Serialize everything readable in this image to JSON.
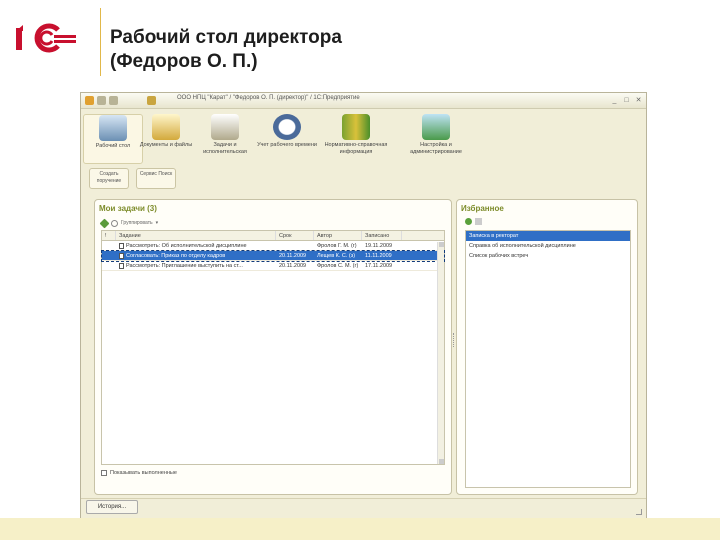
{
  "slide": {
    "title": "Рабочий стол директора\n(Федоров О. П.)",
    "accent_color": "#c8102e"
  },
  "window": {
    "title": "ООО НПЦ \"Карат\" / \"Федоров О. П. (директор)\" / 1С:Предприятие"
  },
  "sections": [
    {
      "label": "Рабочий стол",
      "icon": "desktop-icon"
    },
    {
      "label": "Документы и файлы",
      "icon": "documents-icon"
    },
    {
      "label": "Задачи и исполнительская",
      "icon": "tasks-icon"
    },
    {
      "label": "Учет рабочего времени",
      "icon": "clock-icon"
    },
    {
      "label": "Нормативно-справочная информация",
      "icon": "books-icon"
    },
    {
      "label": "Настройка и администрирование",
      "icon": "settings-icon"
    }
  ],
  "quick_buttons": [
    {
      "label": "Создать поручение"
    },
    {
      "label": "Сервис Поиск"
    }
  ],
  "tasks": {
    "title": "Мои задачи (3)",
    "group_label": "Группировать",
    "columns": [
      "Задание",
      "Срок",
      "Автор",
      "Записано"
    ],
    "rows": [
      {
        "task": "Рассмотреть: Об исполнительской дисциплине",
        "due": "",
        "author": "Фролов Г. М. (г)",
        "recorded": "19.11.2009"
      },
      {
        "task": "Согласовать: Приказ по отделу кадров",
        "due": "20.11.2009",
        "author": "Лещев К. С. (з)",
        "recorded": "11.11.2009"
      },
      {
        "task": "Рассмотреть: Приглашение выступить на ст...",
        "due": "20.11.2009",
        "author": "Фролов С. М. (г)",
        "recorded": "17.11.2009"
      }
    ],
    "show_done_label": "Показывать выполненные"
  },
  "favorites": {
    "title": "Избранное",
    "items": [
      "Записка в ректорат",
      "Справка об исполнительской дисциплине",
      "Список рабочих встреч"
    ]
  },
  "history_label": "История..."
}
